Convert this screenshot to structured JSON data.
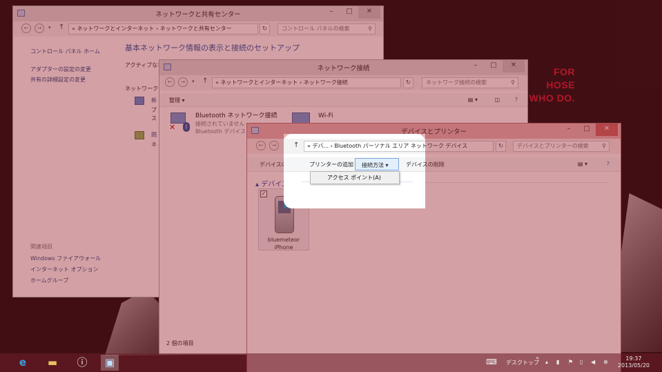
{
  "background": {
    "brand_lines": [
      "FOR",
      "HOSE",
      "WHO DO."
    ],
    "brand_color": "#c8102e"
  },
  "w1": {
    "title": "ネットワークと共有センター",
    "address": "« ネットワークとインターネット › ネットワークと共有センター",
    "search_placeholder": "コントロール パネルの検索",
    "side_home": "コントロール パネル ホーム",
    "side_adapter": "アダプターの設定の変更",
    "side_sharing": "共有の詳細設定の変更",
    "related_header": "関連項目",
    "related_items": [
      "Windows ファイアウォール",
      "インターネット オプション",
      "ホームグループ"
    ],
    "heading": "基本ネットワーク情報の表示と接続のセットアップ",
    "active_networks": "アクティブなネ",
    "network_change": "ネットワーク",
    "snippet_1": "新",
    "snippet_2": "ブ",
    "snippet_3": "ス",
    "snippet_4": "問",
    "snippet_5": "ネ"
  },
  "w2": {
    "title": "ネットワーク接続",
    "address": "« ネットワークとインターネット › ネットワーク接続",
    "search_placeholder": "ネットワーク接続の検索",
    "organize": "整理 ▾",
    "items": [
      {
        "name": "Bluetooth ネットワーク接続",
        "status": "接続されていません",
        "device": "Bluetooth デバイス ("
      },
      {
        "name": "Wi-Fi",
        "status": "",
        "device": ""
      }
    ],
    "count": "2 個の項目"
  },
  "w3": {
    "title": "デバイスとプリンター",
    "address": "« デバ... › Bluetooth パーソナル エリア ネットワーク デバイス",
    "search_placeholder": "デバイスとプリンターの検索",
    "cmd_add_device": "デバイスの追加",
    "cmd_add_printer": "プリンターの追加",
    "cmd_connect": "接続方法 ▾",
    "cmd_remove": "デバイスの削除",
    "group_label": "▴ デバイス (1)",
    "device_name": "bluemeteor iPhone",
    "dropdown_item": "アクセス ポイント(A)"
  },
  "taskbar": {
    "desktop_label": "デスクトップ",
    "time": "19:37",
    "date": "2013/05/20"
  }
}
